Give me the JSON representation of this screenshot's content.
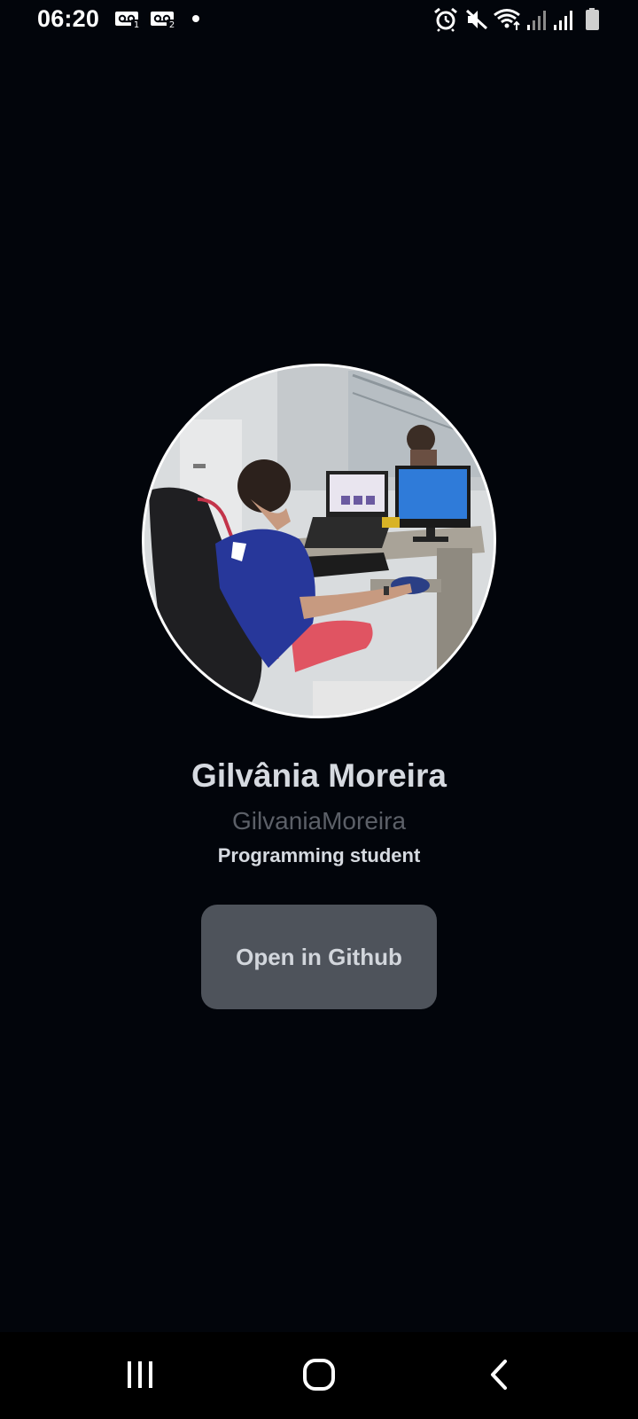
{
  "status_bar": {
    "time": "06:20",
    "left_icons": [
      "voicemail-1-icon",
      "voicemail-2-icon",
      "notification-dot-icon"
    ],
    "right_icons": [
      "alarm-icon",
      "mute-icon",
      "wifi-icon",
      "signal-1-icon",
      "signal-2-icon",
      "battery-icon"
    ]
  },
  "profile": {
    "name": "Gilvânia Moreira",
    "username": "GilvaniaMoreira",
    "bio": "Programming student",
    "button_label": "Open in Github"
  },
  "nav_bar": {
    "buttons": [
      "recent-apps-icon",
      "home-icon",
      "back-icon"
    ]
  },
  "colors": {
    "background": "#02050b",
    "name_text": "#d6dae0",
    "username_text": "#5c6068",
    "button_bg": "#4e535b"
  }
}
